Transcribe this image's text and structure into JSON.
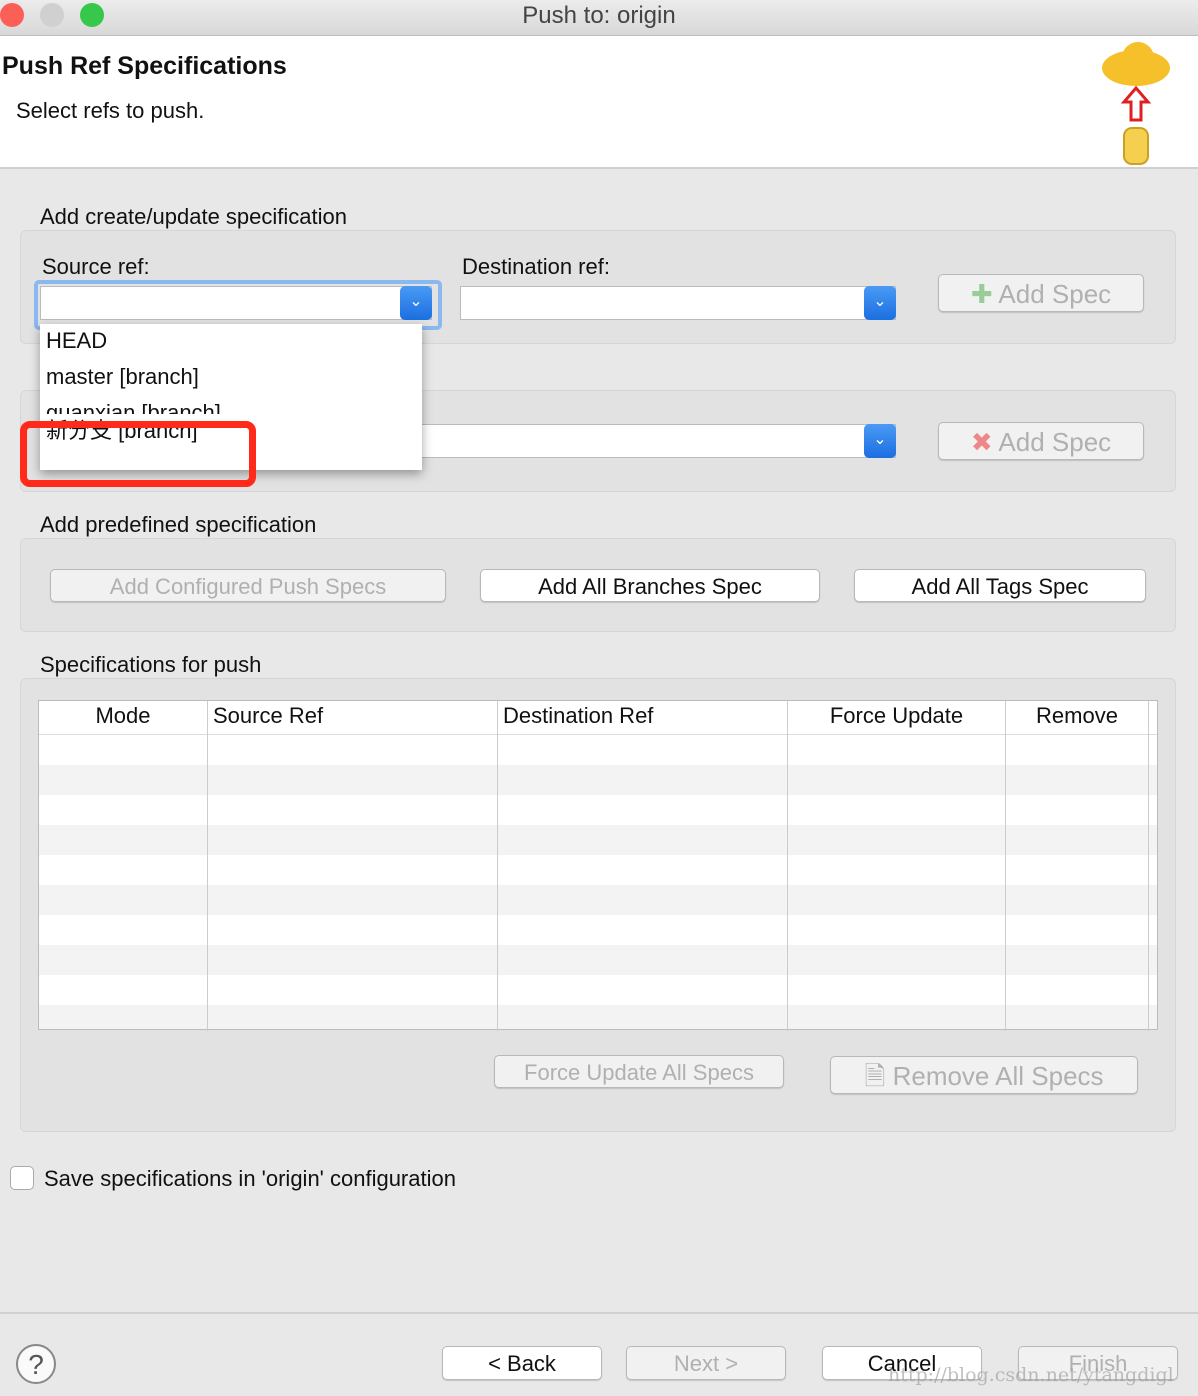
{
  "window": {
    "title": "Push to: origin"
  },
  "header": {
    "title": "Push Ref Specifications",
    "subtitle": "Select refs to push."
  },
  "create_section": {
    "label": "Add create/update specification",
    "source_label": "Source ref:",
    "destination_label": "Destination ref:",
    "source_value": "",
    "destination_value": "",
    "add_spec": "Add Spec"
  },
  "dropdown": {
    "items": [
      "HEAD",
      "master [branch]",
      "guanxian [branch]",
      "新分支 [branch]"
    ],
    "highlight_color": "#ff2a1a"
  },
  "delete_section": {
    "add_spec": "Add Spec"
  },
  "predefined": {
    "label": "Add predefined specification",
    "configured": "Add Configured Push Specs",
    "branches": "Add All Branches Spec",
    "tags": "Add All Tags Spec"
  },
  "specs": {
    "label": "Specifications for push",
    "columns": [
      "Mode",
      "Source Ref",
      "Destination Ref",
      "Force Update",
      "Remove"
    ],
    "force_all": "Force Update All Specs",
    "remove_all": "Remove All Specs"
  },
  "save": {
    "label": "Save specifications in 'origin' configuration",
    "checked": false
  },
  "footer": {
    "back": "< Back",
    "next": "Next >",
    "cancel": "Cancel",
    "finish": "Finish"
  },
  "watermark": "http://blog.csdn.net/ytangdigl"
}
